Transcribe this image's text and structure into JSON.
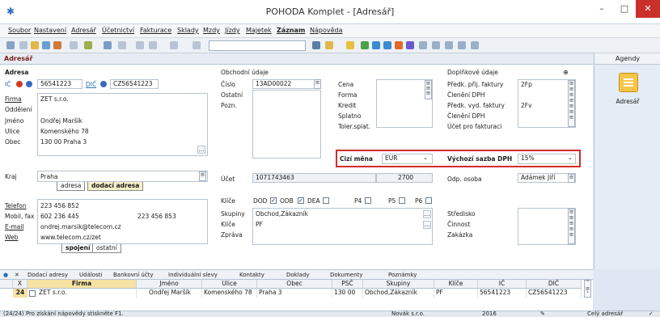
{
  "window": {
    "title": "POHODA Komplet - [Adresář]",
    "minimize": "–",
    "maximize": "□",
    "close": "✕",
    "appicon": "✱"
  },
  "menu": [
    "Soubor",
    "Nastavení",
    "Adresář",
    "Účetnictví",
    "Fakturace",
    "Sklady",
    "Mzdy",
    "Jízdy",
    "Majetek",
    "Záznam",
    "Nápověda"
  ],
  "section_title": "Adresář",
  "agenda": {
    "header": "Agendy",
    "item": "Adresář"
  },
  "adresa": {
    "header": "Adresa",
    "ico": "56541223",
    "dic_label": "DIČ",
    "dic": "CZ56541223",
    "firma_label": "Firma",
    "firma": "ZET s.r.o.",
    "oddeleni_label": "Oddělení",
    "jmeno_label": "Jméno",
    "jmeno": "Ondřej Maršík",
    "ulice_label": "Ulice",
    "ulice": "Komenského 78",
    "obec_label": "Obec",
    "obec": "130 00  Praha 3",
    "kraj_label": "Kraj",
    "kraj": "Praha",
    "tab_adresa": "adresa",
    "tab_dodaci": "dodací adresa",
    "telefon_label": "Telefon",
    "telefon": "223 456 852",
    "mobil_label": "Mobil, fax",
    "mobil": "602 236 445",
    "fax": "223 456 853",
    "email_label": "E-mail",
    "email": "ondrej.marsik@telecom.cz",
    "web_label": "Web",
    "web": "www.telecom.cz/zet",
    "tab_spojeni": "spojení",
    "tab_ostatni": "ostatní"
  },
  "obchodni": {
    "header": "Obchodní údaje",
    "cislo_label": "Číslo",
    "cislo": "13AD00022",
    "ostatni_label": "Ostatní",
    "pozn_label": "Pozn.",
    "cena_label": "Cena",
    "forma_label": "Forma",
    "kredit_label": "Kredit",
    "splatno_label": "Splatno",
    "toler_label": "Toler.splat.",
    "cizi_mena_label": "Cizí měna",
    "cizi_mena": "EUR",
    "ucet_label": "Účet",
    "ucet": "1071743463",
    "ucet_kod": "2700",
    "klice_label": "Klíče",
    "checks": [
      {
        "label": "DOD",
        "checked": true
      },
      {
        "label": "ODB",
        "checked": true
      },
      {
        "label": "DEA",
        "checked": false
      },
      {
        "label": "P4",
        "checked": false
      },
      {
        "label": "P5",
        "checked": false
      },
      {
        "label": "P6",
        "checked": false
      }
    ],
    "skupiny_label": "Skupiny",
    "skupiny": "Obchod,Zákazník",
    "klice2_label": "Klíče",
    "klice2": "PF",
    "zprava_label": "Zpráva"
  },
  "doplnkove": {
    "header": "Doplňkové údaje",
    "predk_prij_label": "Předk. přij. faktury",
    "predk_prij": "2Fp",
    "cleneni1_label": "Členění DPH",
    "predk_vyd_label": "Předk. vyd. faktury",
    "predk_vyd": "2Fv",
    "cleneni2_label": "Členění DPH",
    "ucet_fakt_label": "Účet pro fakturaci",
    "sazba_label": "Výchozí sazba DPH",
    "sazba": "15%",
    "odp_osoba_label": "Odp. osoba",
    "odp_osoba": "Adámek Jiří",
    "stredisko_label": "Středisko",
    "cinnost_label": "Činnost",
    "zakazka_label": "Zakázka"
  },
  "bottom_tabs": [
    "Dodací adresy",
    "Události",
    "Bankovní účty",
    "Individuální slevy",
    "Kontakty",
    "Doklady",
    "Dokumenty",
    "Poznámky"
  ],
  "grid": {
    "columns": [
      "X",
      "Firma",
      "Jméno",
      "Ulice",
      "Obec",
      "PSČ",
      "Skupiny",
      "Klíče",
      "IČ",
      "DIČ"
    ],
    "row": {
      "num": "24",
      "firma": "ZET s.r.o.",
      "jmeno": "Ondřej Maršík",
      "ulice": "Komenského 78",
      "obec": "Praha 3",
      "psc": "130 00",
      "skupiny": "Obchod,Zákazník",
      "klice": "PF",
      "ic": "56541223",
      "dic": "CZ56541223"
    }
  },
  "status": {
    "hint": "(24/24) Pro získání nápovědy stiskněte F1.",
    "firma": "Novák s.r.o.",
    "rok": "2016",
    "mode": "Celý adresář"
  }
}
